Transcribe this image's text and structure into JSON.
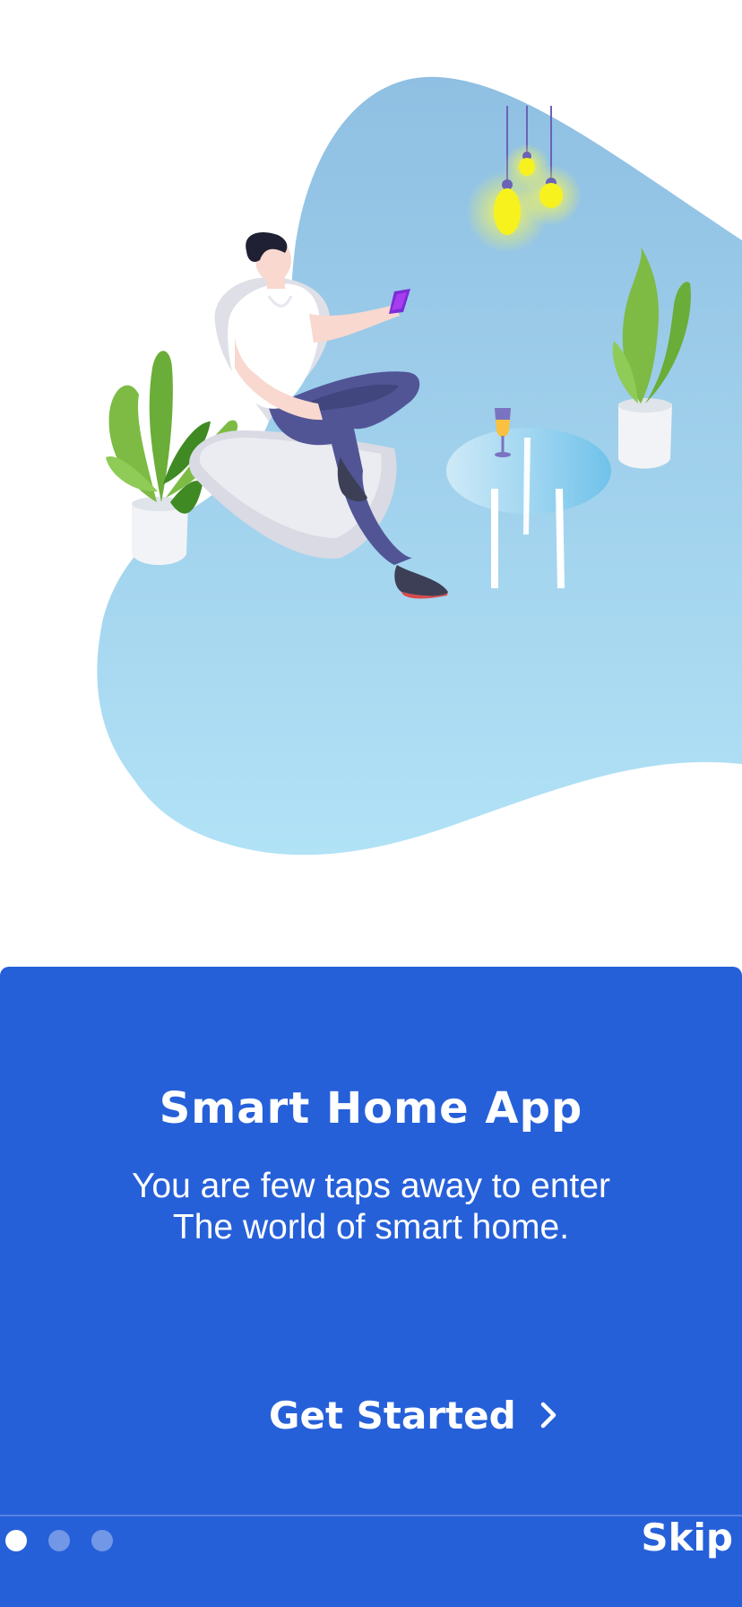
{
  "colors": {
    "panel_background": "#2660d9",
    "text": "#ffffff",
    "illustration_blob_top": "#8fbfe2",
    "illustration_blob_bottom": "#b1e2f6"
  },
  "illustration": {
    "name": "person-on-chair-with-phone-illustration"
  },
  "onboarding": {
    "title": "Smart Home App",
    "subtitle_line1": "You are few taps away to enter",
    "subtitle_line2": "The world of smart home.",
    "cta_label": "Get Started",
    "cta_icon": "chevron-right-icon",
    "skip_label": "Skip",
    "page_indicator": {
      "total": 3,
      "current": 1
    }
  }
}
